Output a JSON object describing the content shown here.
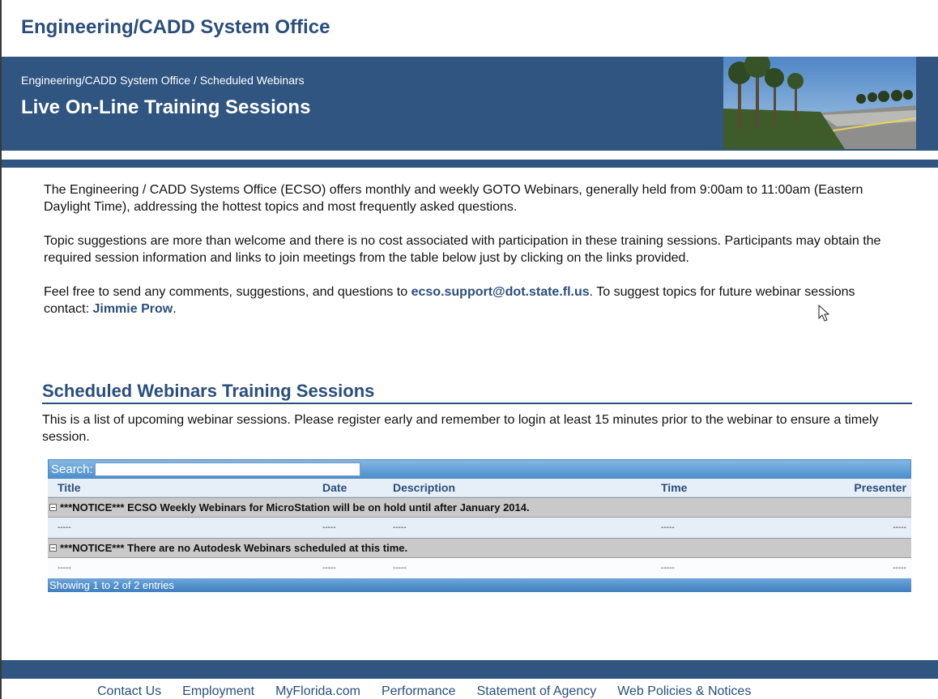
{
  "site": {
    "title": "Engineering/CADD System Office"
  },
  "banner": {
    "breadcrumb": "Engineering/CADD System Office / Scheduled Webinars",
    "title": "Live On-Line Training Sessions"
  },
  "intro": {
    "p1": "The Engineering / CADD Systems Office (ECSO) offers monthly and weekly GOTO Webinars, generally held from 9:00am to 11:00am (Eastern Daylight Time), addressing the hottest topics and most frequently asked questions.",
    "p2": "Topic suggestions are more than welcome and there is no cost associated with participation in these training sessions. Participants may obtain the required session information and links to join meetings from the table below just by clicking on the links provided.",
    "p3_prefix": "Feel free to send any comments, suggestions, and questions to ",
    "email_link": "ecso.support@dot.state.fl.us",
    "p3_middle": ". To suggest topics for future webinar sessions contact: ",
    "contact_link": "Jimmie Prow",
    "p3_suffix": "."
  },
  "section": {
    "title": "Scheduled Webinars Training Sessions",
    "description": "This is a list of upcoming webinar sessions. Please register early and remember to login at least 15 minutes prior to the webinar to ensure a timely session."
  },
  "grid": {
    "search_label": "Search:",
    "search_value": "",
    "columns": [
      "Title",
      "Date",
      "Description",
      "Time",
      "Presenter"
    ],
    "groups": [
      {
        "label": "***NOTICE*** ECSO Weekly Webinars for MicroStation will be on hold until after January 2014.",
        "row": [
          "-----",
          "-----",
          "-----",
          "-----",
          "-----"
        ]
      },
      {
        "label": "***NOTICE*** There are no Autodesk Webinars scheduled at this time.",
        "row": [
          "-----",
          "-----",
          "-----",
          "-----",
          "-----"
        ]
      }
    ],
    "footer": "Showing 1 to 2 of 2 entries"
  },
  "footer": {
    "links": [
      "Contact Us",
      "Employment",
      "MyFlorida.com",
      "Performance",
      "Statement of Agency",
      "Web Policies & Notices"
    ]
  },
  "colors": {
    "brand_blue": "#2f5580",
    "link_blue": "#2a4e7c",
    "grid_blue": "#4d8fcc",
    "group_gray": "#c9c9c9"
  }
}
